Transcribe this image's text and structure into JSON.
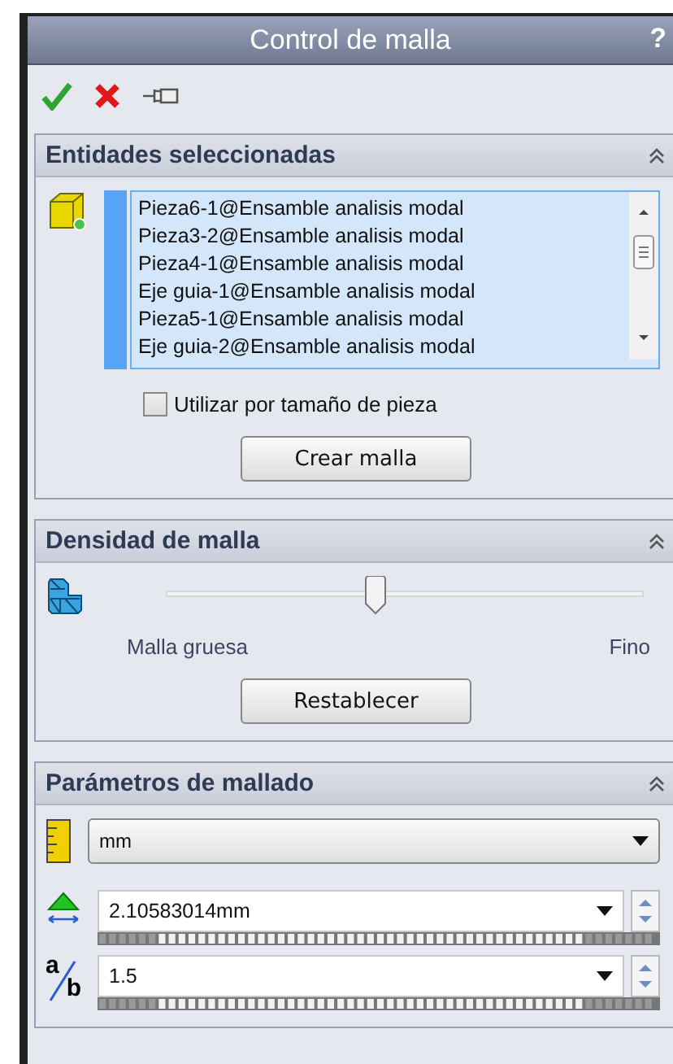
{
  "window": {
    "title": "Control de malla",
    "help": "?"
  },
  "toolbar": [
    {
      "kind": "ok"
    },
    {
      "kind": "cancel"
    },
    {
      "kind": "pin"
    }
  ],
  "sections": [
    {
      "kind": "entities",
      "title": "Entidades seleccionadas",
      "expanded": true,
      "items": [
        "Pieza6-1@Ensamble analisis modal",
        "Pieza3-2@Ensamble analisis modal",
        "Pieza4-1@Ensamble analisis modal",
        "Eje guia-1@Ensamble analisis modal",
        "Pieza5-1@Ensamble analisis modal",
        "Eje guia-2@Ensamble analisis modal"
      ],
      "checkbox": {
        "label": "Utilizar por tamaño de pieza",
        "checked": false
      },
      "button": "Crear malla"
    },
    {
      "kind": "density",
      "title": "Densidad de malla",
      "expanded": true,
      "slider": {
        "level": 0.44,
        "min_label": "Malla gruesa",
        "max_label": "Fino"
      },
      "button": "Restablecer"
    },
    {
      "kind": "params",
      "title": "Parámetros de mallado",
      "expanded": true,
      "unit": "mm",
      "fields": [
        {
          "kind": "size",
          "value": "2.10583014mm"
        },
        {
          "kind": "ratio",
          "value": "1.5",
          "icon_top": "a",
          "icon_bottom": "b"
        }
      ]
    }
  ]
}
